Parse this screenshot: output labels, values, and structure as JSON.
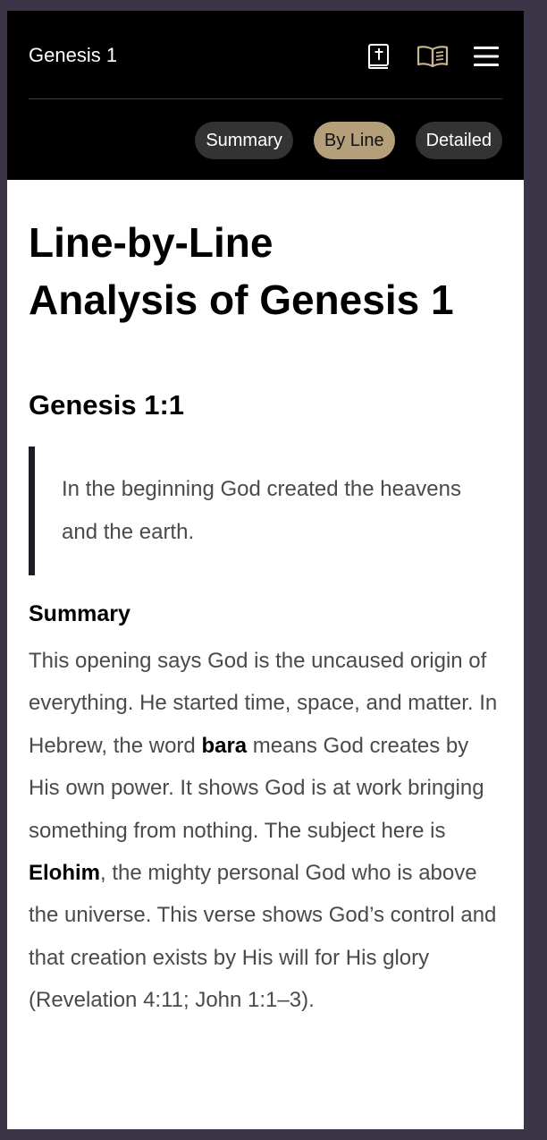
{
  "header": {
    "title": "Genesis 1",
    "icons": [
      "bible-icon",
      "open-book-icon",
      "hamburger-menu-icon"
    ]
  },
  "tabs": [
    {
      "label": "Summary",
      "active": false
    },
    {
      "label": "By Line",
      "active": true
    },
    {
      "label": "Detailed",
      "active": false
    }
  ],
  "colors": {
    "header_bg": "#000000",
    "tab_bg": "#333333",
    "tab_active_bg": "#b59f7b",
    "icon_gold": "#c9b48f",
    "quote_border": "#1c1d24",
    "outer_bg": "#3b3547"
  },
  "main": {
    "title_line1": "Line-by-Line",
    "title_line2": "Analysis of Genesis 1",
    "verse_heading": "Genesis 1:1",
    "verse_quote": "In the beginning God created the heavens and the earth.",
    "summary_heading": "Summary",
    "summary_parts": {
      "p1": "This opening says God is the uncaused origin of everything. He started time, space, and matter. In Hebrew, the word ",
      "b1": "bara",
      "p2": " means God creates by His own power. It shows God is at work bringing something from nothing. The subject here is ",
      "b2": "Elohim",
      "p3": ", the mighty personal God who is above the universe. This verse shows God’s control and that creation exists by His will for His glory (Revelation 4:11; John 1:1–3)."
    }
  }
}
